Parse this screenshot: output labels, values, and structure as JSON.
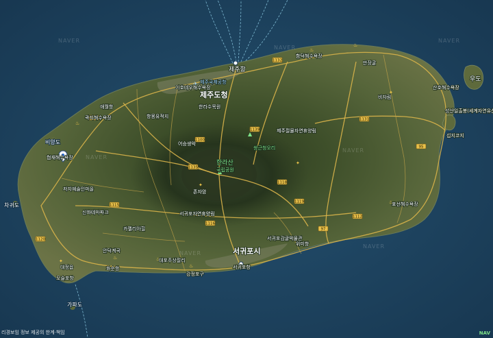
{
  "watermark": "NAVER",
  "footer": {
    "text": "리경보임 정보 제공의 한계·책임",
    "logo": "NAV"
  },
  "places": {
    "jeju_city": "제주도청",
    "jeju_port": "제주항",
    "airport": "제주국제공항",
    "hallasan": "한라산",
    "hallasan_park": "국립공원",
    "seogwipo": "서귀포시",
    "seogwipo_port": "서귀포항",
    "udo": "우도",
    "seongsan": "성산일출봉(세계자연유산)",
    "sanho_beach": "산호해수욕장",
    "seopjikoji": "섭지코지",
    "biyangdo": "비양도",
    "chagwido": "차귀도",
    "gapado": "가파도",
    "moseulpo": "모슬포항",
    "hamdeok": "함덕해수욕장",
    "manjanggul": "만장굴",
    "bijarim": "비자림",
    "jeju_museum": "제주절물자연휴양림",
    "yongnuni": "쌍근청오리",
    "pyoseon": "표선해수욕장",
    "wimi": "위미항",
    "jungmun": "중문관광단지",
    "songak": "송악산",
    "hwasun": "화순항",
    "daepo": "대포주상절리",
    "gangjeong": "강정포구",
    "aewol": "애월항",
    "gwakji": "곽지해수욕장",
    "hyeopjae": "협재해수욕장",
    "hallim": "한림",
    "jeoji": "저지예술인마을",
    "sinhwa": "신화테마파크",
    "camellia": "카멜리아힐",
    "ojeong": "오라올레",
    "iho": "이호테우해수욕장",
    "jeju_univ": "한라수목원",
    "hangpadu": "항몽유적지",
    "eorimok": "어승생악",
    "jonjaeak": "존자암",
    "seogwipo_forest": "서귀포자연휴양림",
    "seogwipo_olle": "서귀포감귤박물관",
    "daejeong": "대정읍",
    "sanbang": "산방산",
    "andeok": "안덕계곡"
  },
  "road_numbers": [
    "1132",
    "1136",
    "1139",
    "1115",
    "1118",
    "1131",
    "1112",
    "1119",
    "1116",
    "1135",
    "1120",
    "1100",
    "97",
    "95"
  ]
}
